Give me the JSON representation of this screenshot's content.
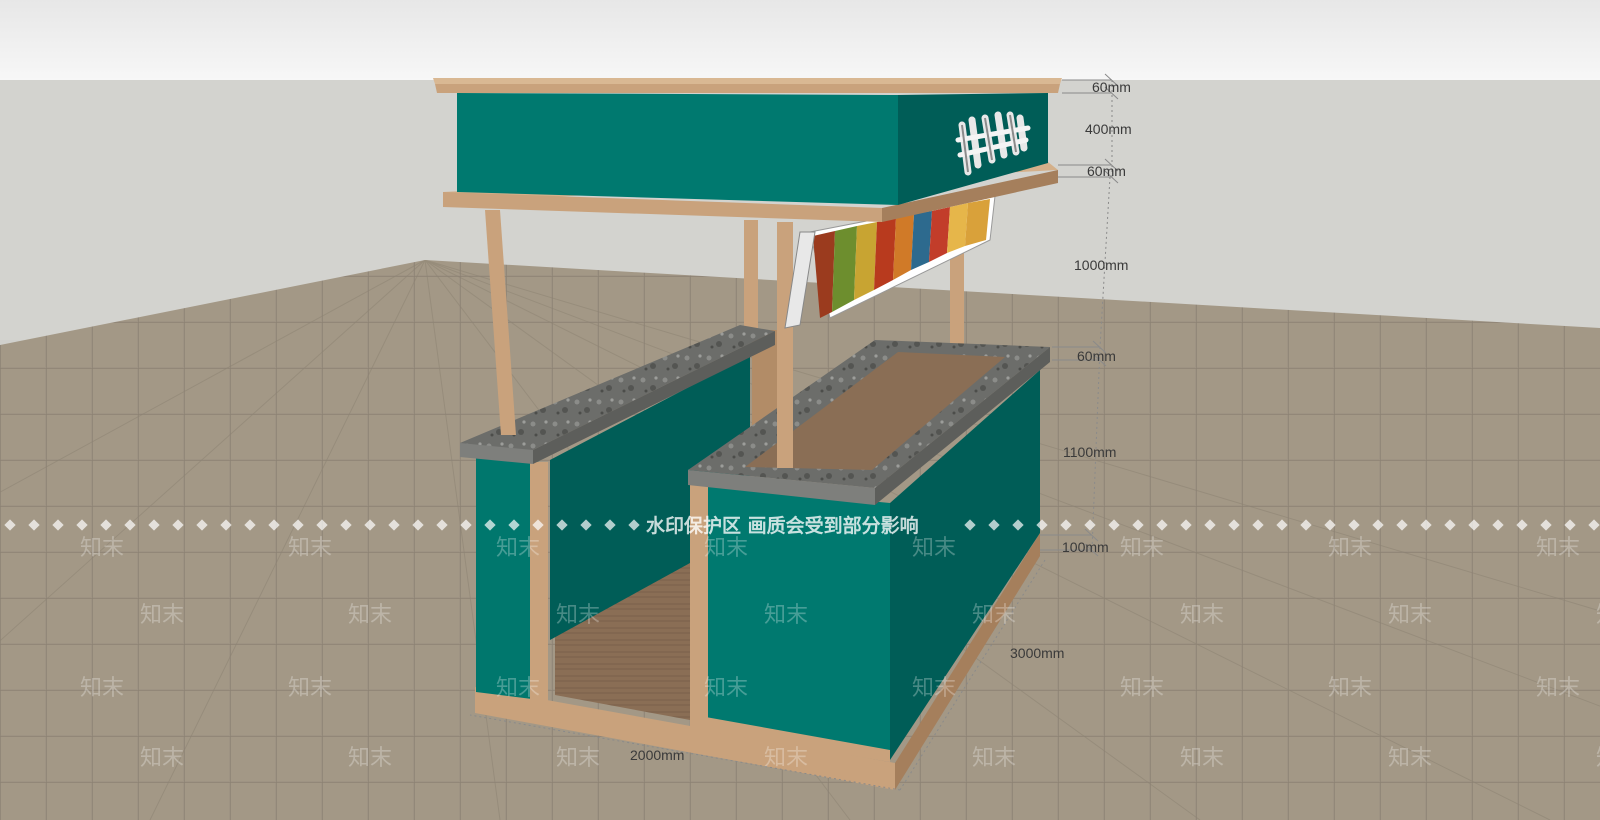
{
  "dimensions": {
    "top_board": "60mm",
    "sign_height": "400mm",
    "sign_base_board": "60mm",
    "column_height": "1000mm",
    "counter_top": "60mm",
    "counter_height": "1100mm",
    "base": "100mm",
    "depth": "3000mm",
    "width": "2000mm"
  },
  "watermark": {
    "band_text": "水印保护区  画质会受到部分影响",
    "tile_text": "知末"
  },
  "colors": {
    "sky": "#eeeeee",
    "wall": "#d3d3cf",
    "floor": "#9d9282",
    "teal_front": "#00796f",
    "teal_side": "#005d57",
    "wood": "#c9a27c",
    "wood_dark": "#a57f5c",
    "stone": "#6f706d",
    "dim_line": "#8a8a8a"
  },
  "icons": {
    "sign_logo": "chinese-calligraphy-logo",
    "poster_rack": "magazine-poster-rack"
  }
}
